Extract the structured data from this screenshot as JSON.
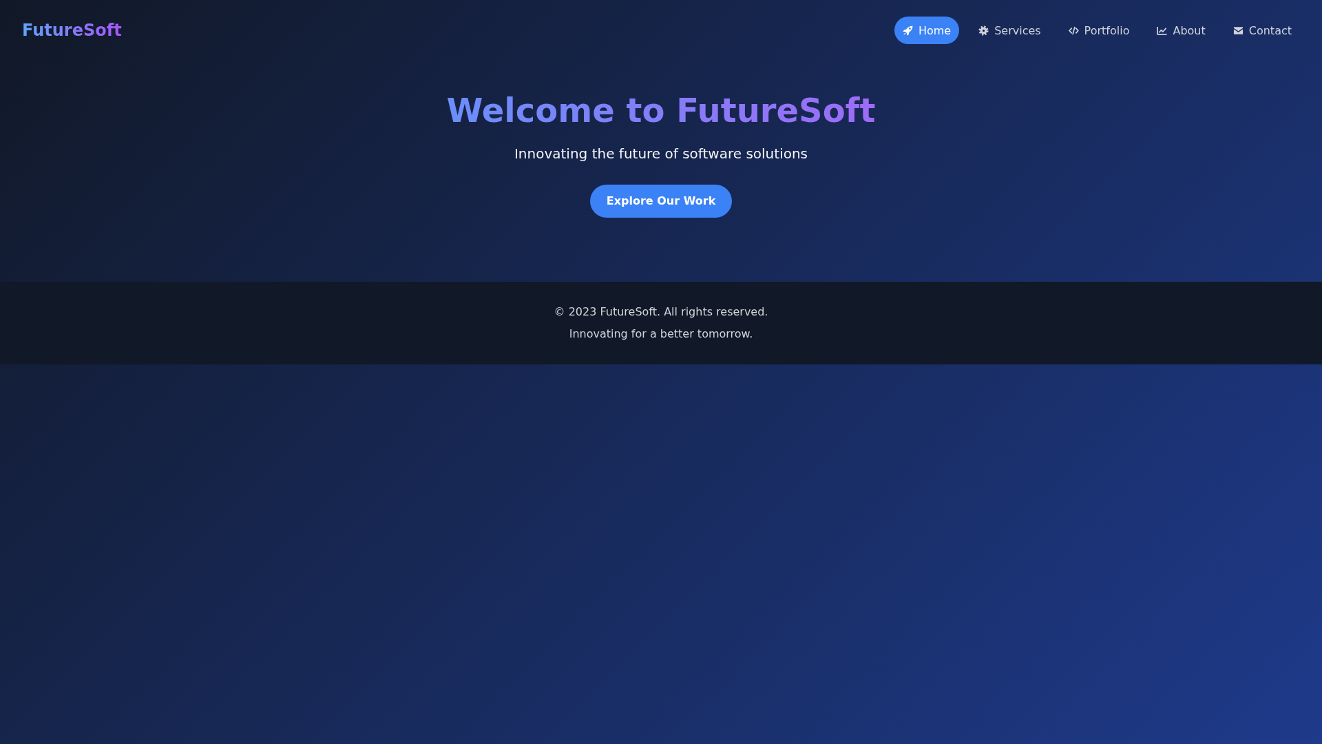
{
  "header": {
    "logo": "FutureSoft",
    "nav": [
      {
        "label": "Home",
        "kind": "home",
        "selected": true
      },
      {
        "label": "Services",
        "kind": "services",
        "selected": false
      },
      {
        "label": "Portfolio",
        "kind": "portfolio",
        "selected": false
      },
      {
        "label": "About",
        "kind": "about",
        "selected": false
      },
      {
        "label": "Contact",
        "kind": "contact",
        "selected": false
      }
    ]
  },
  "hero": {
    "title": "Welcome to FutureSoft",
    "subtitle": "Innovating the future of software solutions",
    "button": "Explore Our Work"
  },
  "footer": {
    "lines": [
      "© 2023 FutureSoft. All rights reserved.",
      "Innovating for a better tomorrow."
    ]
  }
}
